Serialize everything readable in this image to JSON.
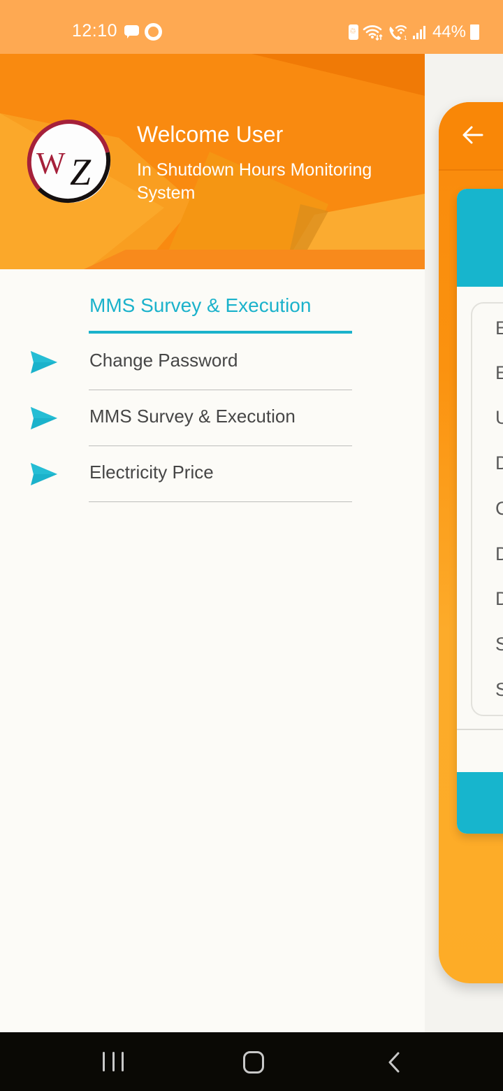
{
  "status_bar": {
    "time": "12:10",
    "battery_percent": "44%",
    "left_icons": [
      "message-icon",
      "ring-app-icon"
    ],
    "right_icons": [
      "battery-saver-icon",
      "wifi-icon",
      "wifi-calling-icon",
      "signal-icon",
      "battery-charging-icon"
    ]
  },
  "drawer": {
    "header": {
      "logo_text": "WZ",
      "welcome": "Welcome User",
      "subtitle": "In Shutdown Hours Monitoring System"
    },
    "section_title": "MMS Survey & Execution",
    "items": [
      {
        "label": "Change Password",
        "icon": "send-arrow-icon"
      },
      {
        "label": "MMS Survey & Execution",
        "icon": "send-arrow-icon"
      },
      {
        "label": "Electricity Price",
        "icon": "send-arrow-icon"
      }
    ]
  },
  "background_app": {
    "back_icon": "arrow-left-icon",
    "list_initials": [
      "E",
      "E",
      "U",
      "D",
      "C",
      "D",
      "D",
      "S",
      "S"
    ]
  },
  "colors": {
    "accent": "#1bb2cb",
    "header_orange": "#f98a10",
    "status_bar": "#fea952",
    "text_primary": "#464646"
  },
  "nav_bar": {
    "buttons": [
      "recent-apps",
      "home",
      "back"
    ]
  }
}
